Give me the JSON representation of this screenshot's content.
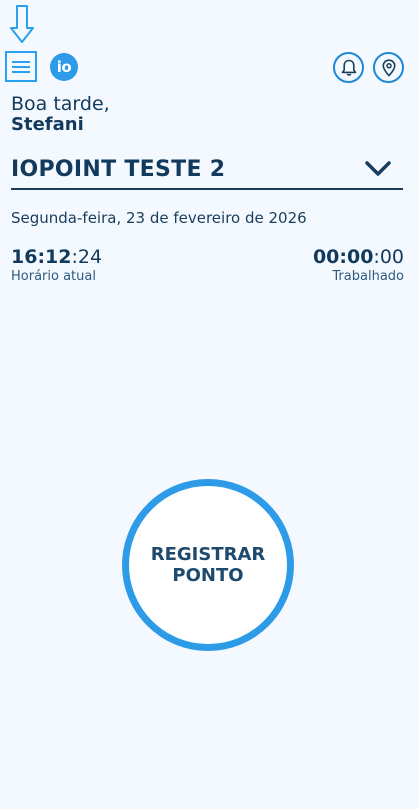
{
  "header": {
    "logo_text": "io",
    "icons": [
      "arrow-down-icon",
      "menu-icon",
      "bell-icon",
      "location-pin-icon"
    ]
  },
  "greeting": {
    "line1": "Boa tarde,",
    "name": "Stefani"
  },
  "company": {
    "selected": "IOPOINT TESTE 2"
  },
  "date": "Segunda-feira, 23 de fevereiro de 2026",
  "current_time": {
    "hours_minutes": "16:12",
    "seconds": ":24",
    "label": "Horário atual"
  },
  "worked_time": {
    "hours_minutes": "00:00",
    "seconds": ":00",
    "label": "Trabalhado"
  },
  "register_button": {
    "line1": "REGISTRAR",
    "line2": "PONTO"
  },
  "colors": {
    "background": "#f3f9fe",
    "accent": "#2d9be8",
    "text": "#123a5c"
  }
}
